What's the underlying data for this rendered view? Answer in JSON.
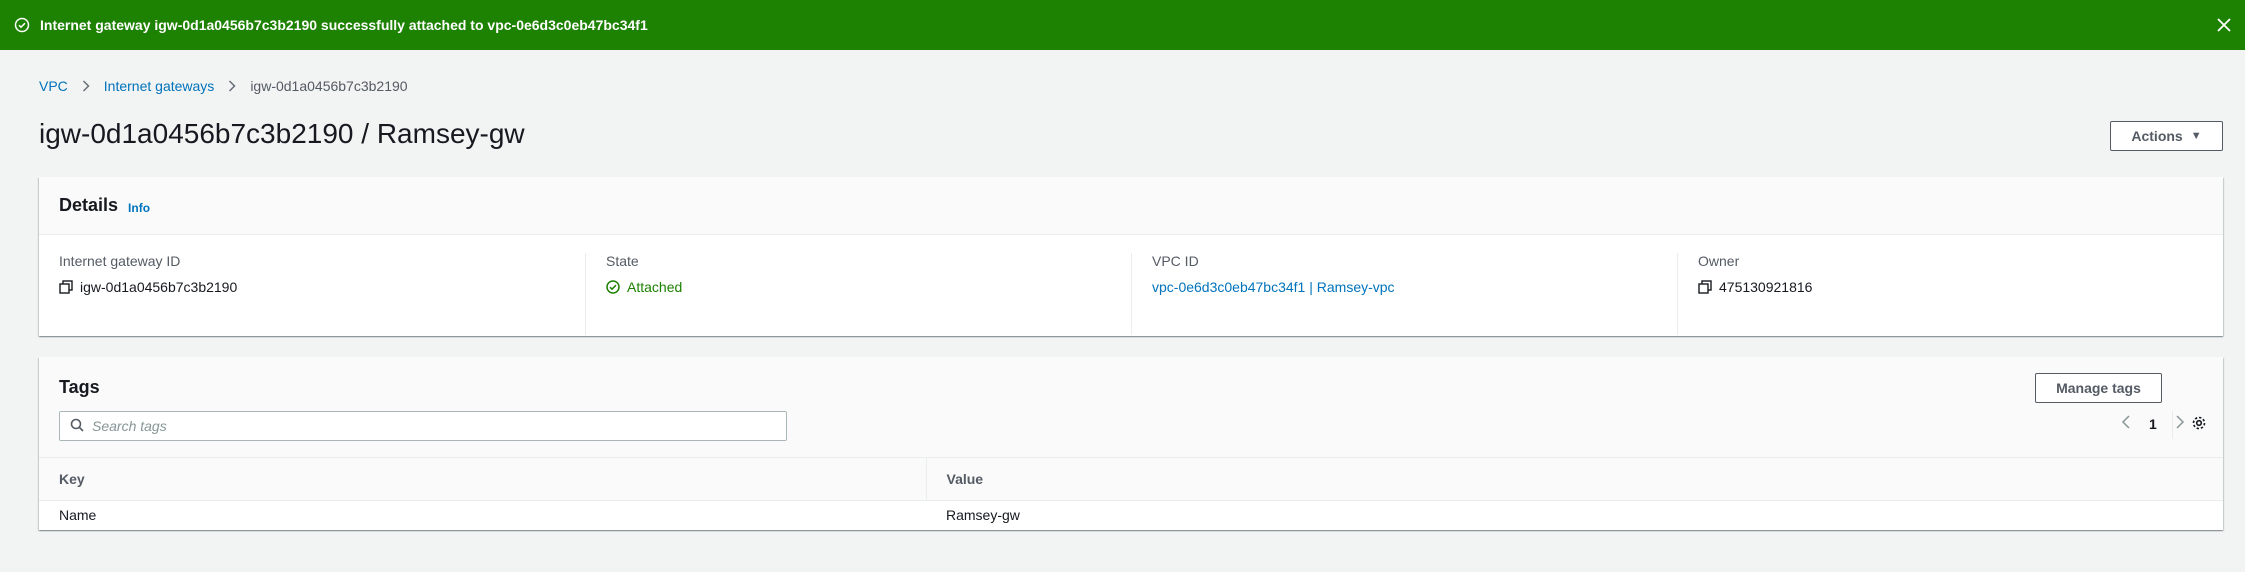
{
  "flash": {
    "message": "Internet gateway igw-0d1a0456b7c3b2190 successfully attached to vpc-0e6d3c0eb47bc34f1"
  },
  "breadcrumb": {
    "items": [
      "VPC",
      "Internet gateways"
    ],
    "current": "igw-0d1a0456b7c3b2190"
  },
  "page": {
    "title": "igw-0d1a0456b7c3b2190 / Ramsey-gw",
    "actions_label": "Actions"
  },
  "details": {
    "title": "Details",
    "info_label": "Info",
    "fields": [
      {
        "label": "Internet gateway ID",
        "value": "igw-0d1a0456b7c3b2190"
      },
      {
        "label": "State",
        "value": "Attached"
      },
      {
        "label": "VPC ID",
        "value": "vpc-0e6d3c0eb47bc34f1 | Ramsey-vpc"
      },
      {
        "label": "Owner",
        "value": "475130921816"
      }
    ]
  },
  "tags": {
    "title": "Tags",
    "manage_label": "Manage tags",
    "search_placeholder": "Search tags",
    "page_number": "1",
    "columns": [
      "Key",
      "Value"
    ],
    "rows": [
      {
        "key": "Name",
        "value": "Ramsey-gw"
      }
    ]
  },
  "colors": {
    "success": "#1d8102",
    "link": "#0073bb",
    "background": "#f2f3f3"
  }
}
